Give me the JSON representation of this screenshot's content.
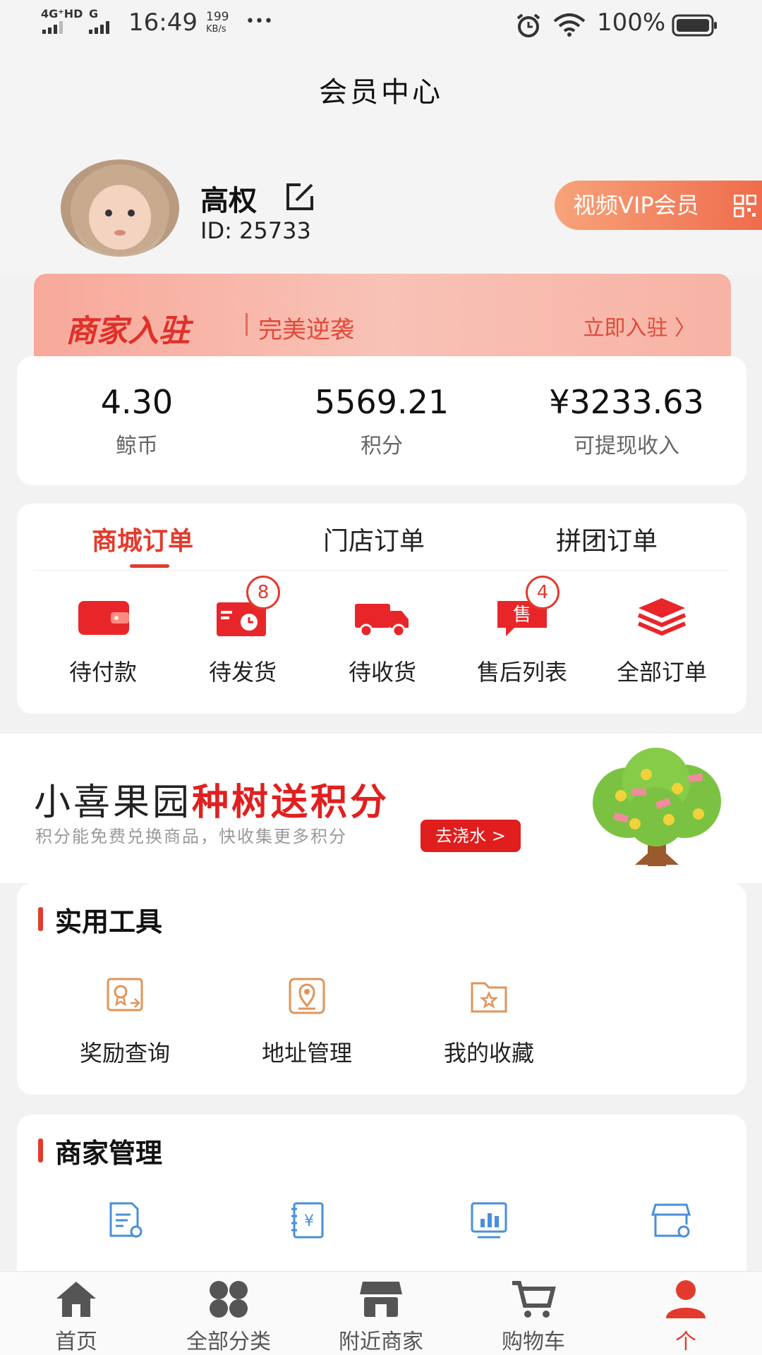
{
  "status_bar": {
    "network_1": "4G⁺HD",
    "network_2": "G",
    "time": "16:49",
    "speed_value": "199",
    "speed_unit": "KB/s",
    "more": "•••",
    "battery": "100%"
  },
  "header": {
    "title": "会员中心",
    "user_name": "高权",
    "user_id": "ID: 25733",
    "vip_label": "视频VIP会员"
  },
  "merchant_banner": {
    "title": "商家入驻",
    "subtitle": "完美逆袭",
    "action": "立即入驻 〉"
  },
  "stats": [
    {
      "value": "4.30",
      "label": "鲸币"
    },
    {
      "value": "5569.21",
      "label": "积分"
    },
    {
      "value": "¥3233.63",
      "label": "可提现收入"
    }
  ],
  "order_tabs": [
    {
      "label": "商城订单"
    },
    {
      "label": "门店订单"
    },
    {
      "label": "拼团订单"
    }
  ],
  "order_items": [
    {
      "label": "待付款",
      "icon": "wallet-icon",
      "badge": ""
    },
    {
      "label": "待发货",
      "icon": "shipping-box-icon",
      "badge": "8"
    },
    {
      "label": "待收货",
      "icon": "truck-icon",
      "badge": ""
    },
    {
      "label": "售后列表",
      "icon": "after-sale-icon",
      "badge": "4"
    },
    {
      "label": "全部订单",
      "icon": "layers-icon",
      "badge": ""
    }
  ],
  "orchard": {
    "title_black": "小喜果园",
    "title_red": "种树送积分",
    "subtitle": "积分能免费兑换商品，快收集更多积分",
    "button": "去浇水 >"
  },
  "tools": {
    "title": "实用工具",
    "items": [
      {
        "label": "奖励查询",
        "icon": "reward-certificate-icon"
      },
      {
        "label": "地址管理",
        "icon": "location-pin-icon"
      },
      {
        "label": "我的收藏",
        "icon": "favorite-folder-icon"
      }
    ]
  },
  "merchant_mgmt": {
    "title": "商家管理",
    "items": [
      {
        "icon": "document-settings-icon"
      },
      {
        "icon": "finance-ledger-icon"
      },
      {
        "icon": "bar-chart-icon"
      },
      {
        "icon": "store-settings-icon"
      }
    ]
  },
  "bottom_nav": [
    {
      "label": "首页",
      "icon": "home-icon"
    },
    {
      "label": "全部分类",
      "icon": "grid-icon"
    },
    {
      "label": "附近商家",
      "icon": "shop-icon"
    },
    {
      "label": "购物车",
      "icon": "cart-icon"
    },
    {
      "label": "个",
      "icon": "person-icon"
    }
  ],
  "colors": {
    "accent": "#e23b2d",
    "vip_gradient_start": "#f7a37a",
    "vip_gradient_end": "#ef6a4a"
  }
}
